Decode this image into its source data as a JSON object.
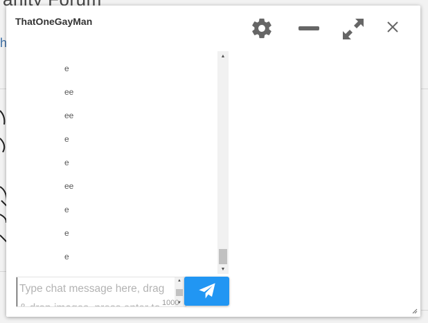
{
  "background": {
    "title_fragment": "anity Forum",
    "link_fragment": "h"
  },
  "chat": {
    "title": "ThatOneGayMan",
    "controls": {
      "settings": "gear-icon",
      "minimize": "minimize-icon",
      "maximize": "expand-icon",
      "close": "close-icon"
    },
    "messages": [
      "e",
      "ee",
      "ee",
      "e",
      "e",
      "ee",
      "e",
      "e",
      "e"
    ],
    "input": {
      "value": "",
      "placeholder": "Type chat message here, drag & drop images, press enter to send"
    },
    "char_count": "1000",
    "send_icon": "paper-plane-icon",
    "colors": {
      "send_button": "#2196f3",
      "icons": "#666666"
    }
  }
}
